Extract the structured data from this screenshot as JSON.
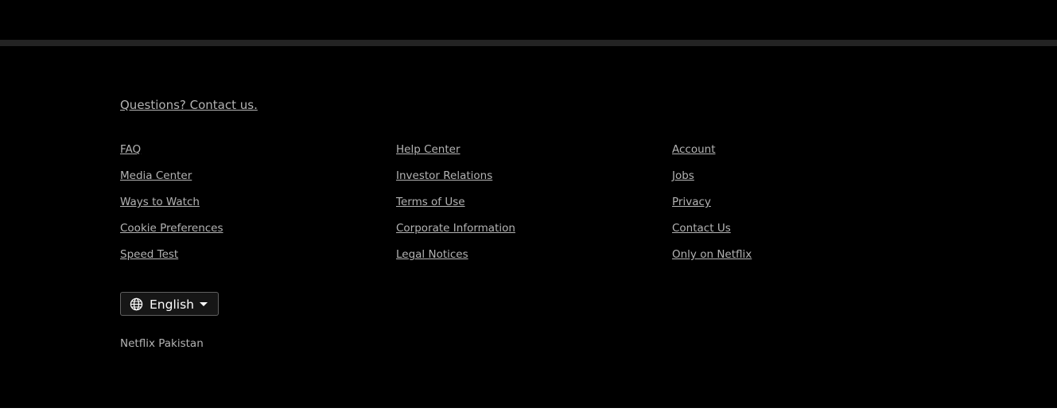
{
  "footer": {
    "contact_text": "Questions? Contact us.",
    "links": [
      "FAQ",
      "Help Center",
      "Account",
      "Media Center",
      "Investor Relations",
      "Jobs",
      "Ways to Watch",
      "Terms of Use",
      "Privacy",
      "Cookie Preferences",
      "Corporate Information",
      "Contact Us",
      "Speed Test",
      "Legal Notices",
      "Only on Netflix"
    ],
    "language_selector": {
      "icon": "globe-icon",
      "selected": "English",
      "caret_icon": "caret-down-icon"
    },
    "region_text": "Netflix Pakistan"
  },
  "colors": {
    "background": "#000000",
    "divider": "#232323",
    "link_text": "#b3b3b3",
    "language_text": "#ffffff"
  }
}
